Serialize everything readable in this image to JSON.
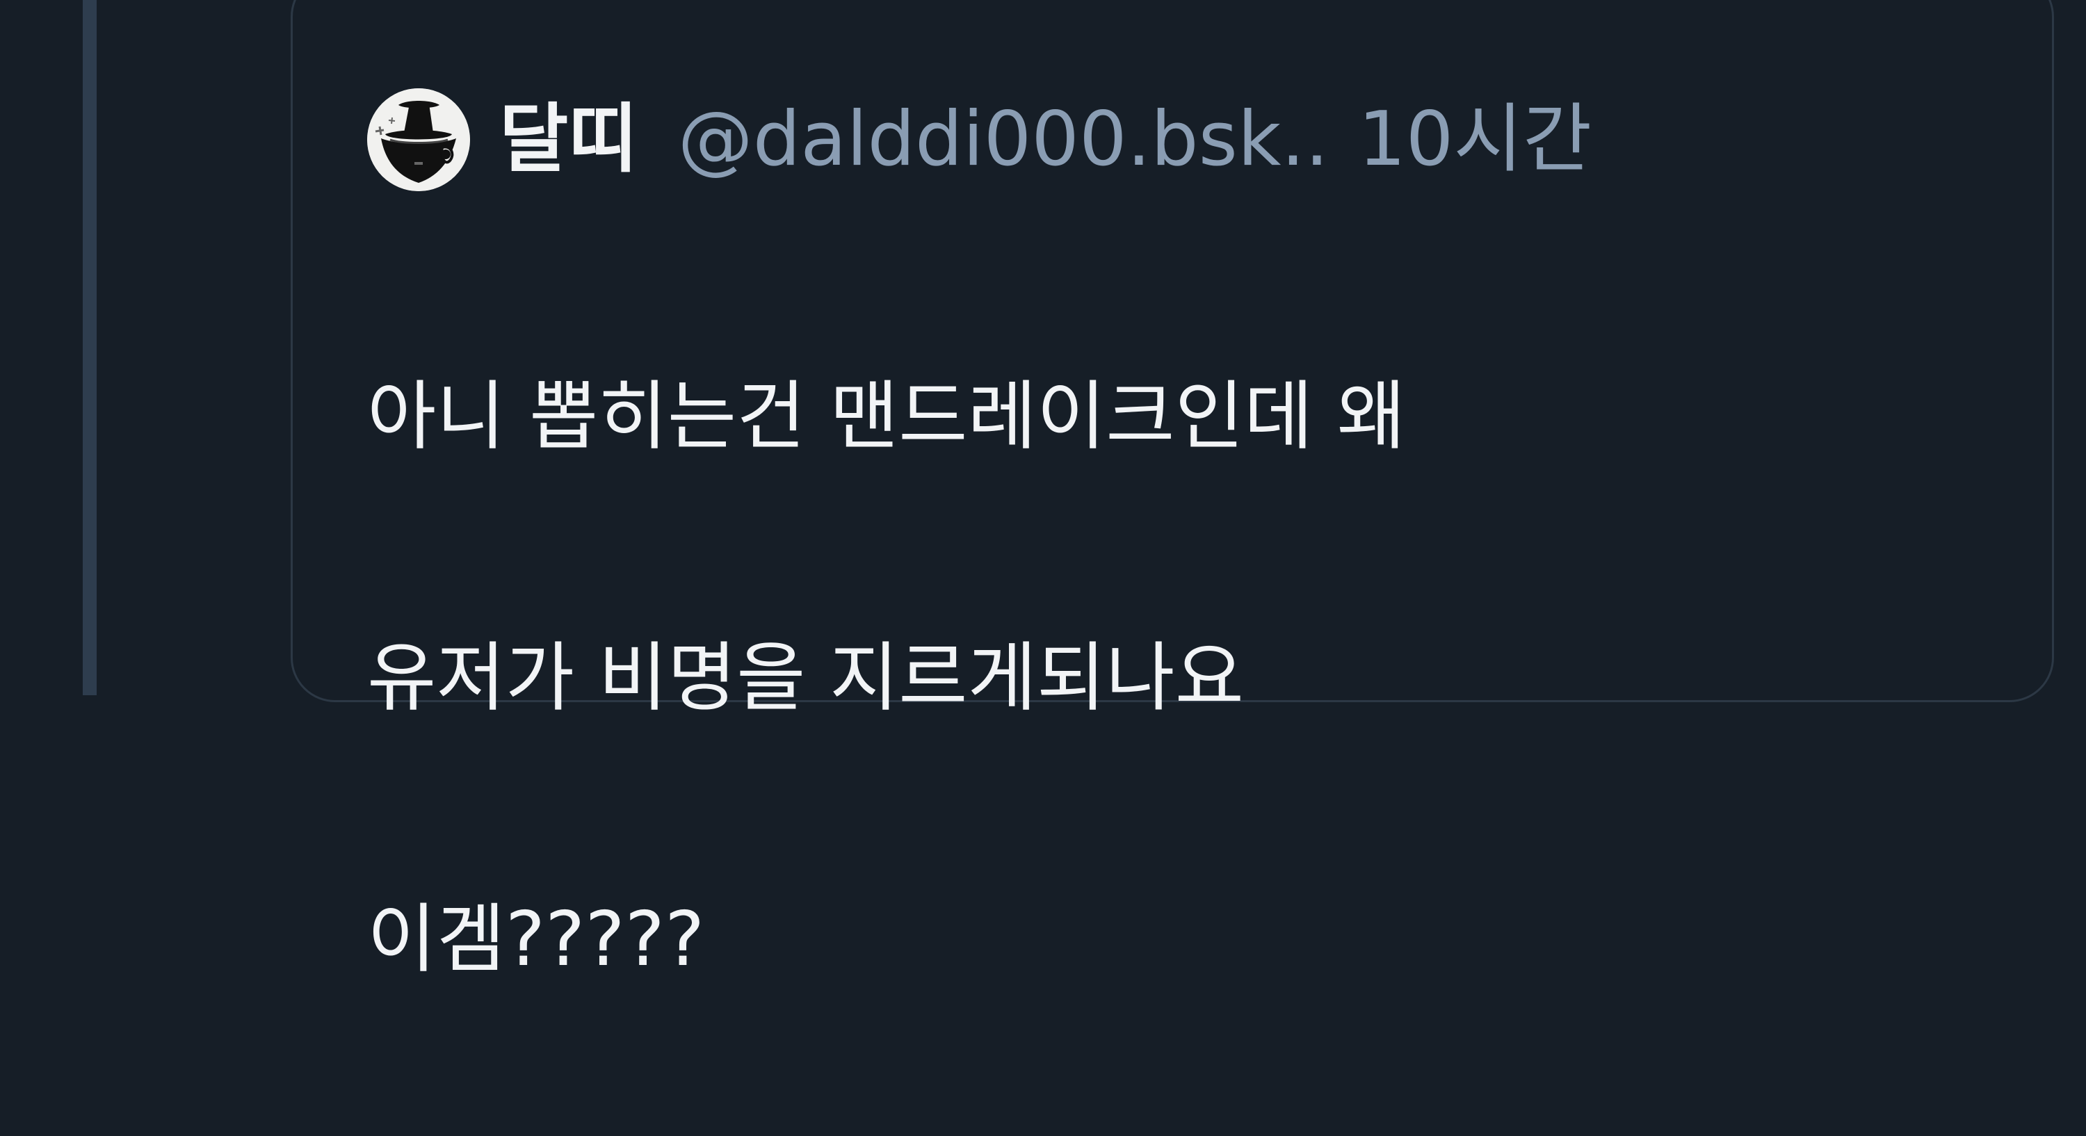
{
  "quote": {
    "author": {
      "avatar_icon": "witch-hat-avatar-icon",
      "display_name": "달띠",
      "handle": "@dalddi000.bsk..",
      "time": "10시간"
    },
    "text_lines": [
      "아니 뽑히는건 맨드레이크인데 왜",
      "유저가 비명을 지르게되나요",
      "이겜?????"
    ]
  },
  "colors": {
    "background": "#161e27",
    "thread_line": "#2e3d4e",
    "card_border": "#2c3845",
    "text_primary": "#f2f4f6",
    "text_secondary": "#8a9db3"
  }
}
